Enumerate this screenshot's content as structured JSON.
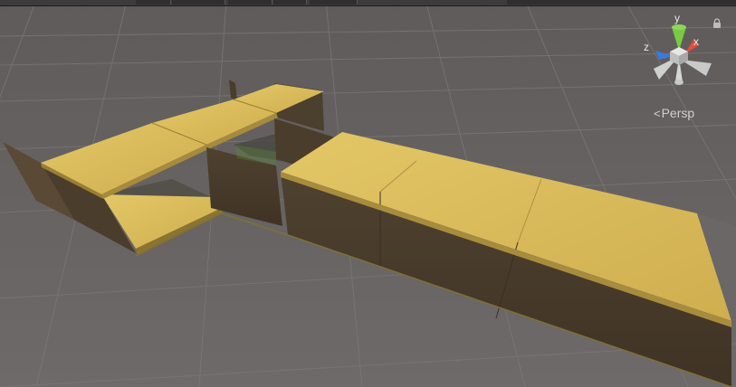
{
  "scene": {
    "background": "#6b6766",
    "grid_color": "#7a7775",
    "block_top_color": "#d8b95a",
    "block_side_color": "#4a3d2c"
  },
  "gizmo": {
    "y_label": "y",
    "x_label": "x",
    "z_label": "z",
    "y_color": "#7ac943",
    "x_color": "#e84c3c",
    "z_color": "#3a7ad9",
    "projection_label": "Persp"
  },
  "topbar": {
    "segments": 6
  }
}
